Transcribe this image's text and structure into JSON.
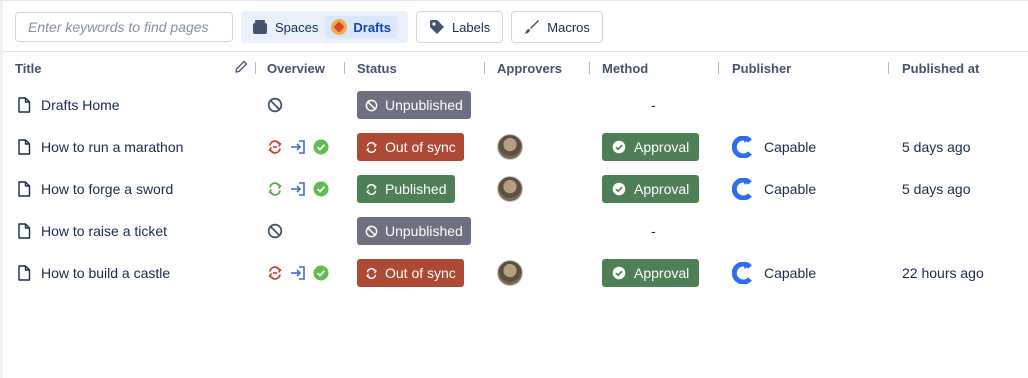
{
  "toolbar": {
    "search_placeholder": "Enter keywords to find pages",
    "spaces_label": "Spaces",
    "drafts_label": "Drafts",
    "labels_label": "Labels",
    "macros_label": "Macros"
  },
  "table": {
    "headers": {
      "title": "Title",
      "overview": "Overview",
      "status": "Status",
      "approvers": "Approvers",
      "method": "Method",
      "publisher": "Publisher",
      "published_at": "Published at"
    },
    "rows": [
      {
        "title": "Drafts Home",
        "overview": "not-published",
        "status": "Unpublished",
        "status_kind": "unpublished",
        "approver": "",
        "method": "-",
        "publisher": "",
        "published_at": ""
      },
      {
        "title": "How to run a marathon",
        "overview": "out-of-sync",
        "status": "Out of sync",
        "status_kind": "outofsync",
        "approver": "avatar",
        "method": "Approval",
        "publisher": "Capable",
        "published_at": "5 days ago"
      },
      {
        "title": "How to forge a sword",
        "overview": "in-sync",
        "status": "Published",
        "status_kind": "published",
        "approver": "avatar",
        "method": "Approval",
        "publisher": "Capable",
        "published_at": "5 days ago"
      },
      {
        "title": "How to raise a ticket",
        "overview": "not-published",
        "status": "Unpublished",
        "status_kind": "unpublished",
        "approver": "",
        "method": "-",
        "publisher": "",
        "published_at": ""
      },
      {
        "title": "How to build a castle",
        "overview": "out-of-sync",
        "status": "Out of sync",
        "status_kind": "outofsync",
        "approver": "avatar",
        "method": "Approval",
        "publisher": "Capable",
        "published_at": "22 hours ago"
      }
    ]
  },
  "colors": {
    "unpublished": "#6c7080",
    "outofsync": "#ae4a33",
    "published": "#4f7f56",
    "approval": "#4f7f56",
    "capable_brand": "#2f6df0"
  }
}
